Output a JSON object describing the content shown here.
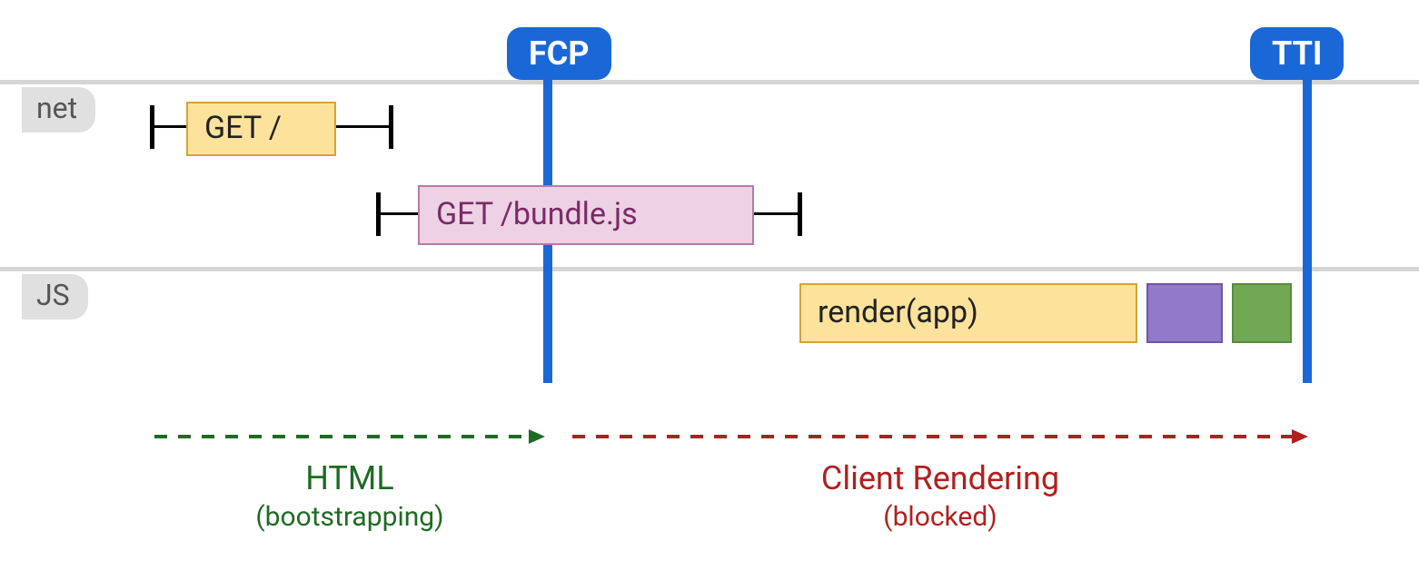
{
  "markers": {
    "fcp": "FCP",
    "tti": "TTI"
  },
  "lanes": {
    "net": "net",
    "js": "JS"
  },
  "net": {
    "get_root": "GET /",
    "get_bundle": "GET /bundle.js"
  },
  "js": {
    "render": "render(app)"
  },
  "phases": {
    "html": {
      "title": "HTML",
      "sub": "(bootstrapping)"
    },
    "client": {
      "title": "Client Rendering",
      "sub": "(blocked)"
    }
  },
  "chart_data": {
    "type": "timeline",
    "title": "Client-side rendering request/render timeline",
    "x_unit": "relative time (arbitrary)",
    "x_range": [
      0,
      100
    ],
    "markers": [
      {
        "name": "FCP",
        "x": 38,
        "color": "#1a68d8"
      },
      {
        "name": "TTI",
        "x": 95,
        "color": "#1a68d8"
      }
    ],
    "lanes": [
      {
        "name": "net",
        "items": [
          {
            "label": "GET /",
            "whisker_start": 5,
            "box_start": 8,
            "box_end": 20,
            "whisker_end": 26,
            "color": "#fde29b"
          },
          {
            "label": "GET /bundle.js",
            "whisker_start": 24,
            "box_start": 28,
            "box_end": 54,
            "whisker_end": 58,
            "color": "#ecd2e4"
          }
        ]
      },
      {
        "name": "JS",
        "items": [
          {
            "label": "render(app)",
            "box_start": 58,
            "box_end": 82,
            "color": "#fde29b"
          },
          {
            "label": "",
            "box_start": 83,
            "box_end": 89,
            "color": "#9379c9"
          },
          {
            "label": "",
            "box_start": 90,
            "box_end": 94,
            "color": "#72a753"
          }
        ]
      }
    ],
    "phases": [
      {
        "label": "HTML",
        "sublabel": "(bootstrapping)",
        "start": 5,
        "end": 38,
        "color": "#1e6b23"
      },
      {
        "label": "Client Rendering",
        "sublabel": "(blocked)",
        "start": 40,
        "end": 95,
        "color": "#b0201f"
      }
    ]
  }
}
